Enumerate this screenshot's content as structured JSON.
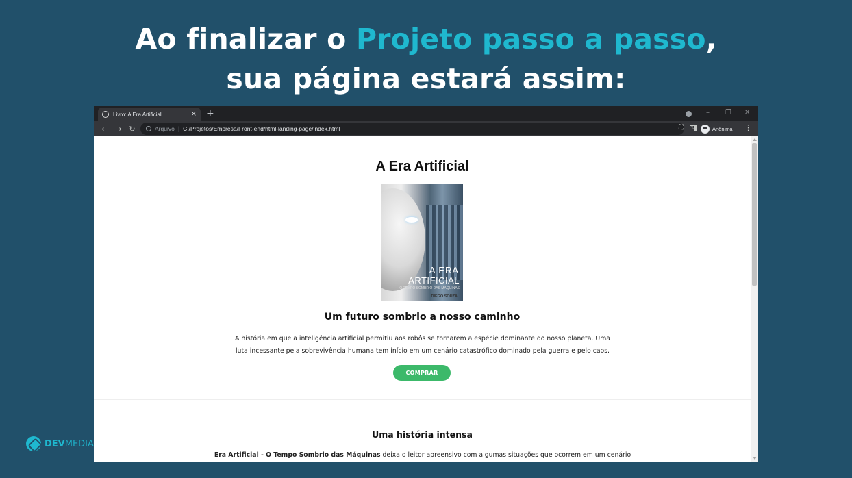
{
  "headline": {
    "line1_before": "Ao finalizar o ",
    "line1_accent": "Projeto passo a passo",
    "line1_after": ",",
    "line2": "sua página estará assim:"
  },
  "colors": {
    "background": "#21506a",
    "accent": "#1fb8cf",
    "buy_button": "#3cb96a"
  },
  "browser": {
    "tab_title": "Livro: A Era Artificial",
    "tab_close": "×",
    "new_tab": "+",
    "window_controls": {
      "minimize": "–",
      "maximize": "❐",
      "close": "✕"
    },
    "nav": {
      "back": "←",
      "forward": "→",
      "reload": "↻"
    },
    "address": {
      "scheme_label": "Arquivo",
      "separator": "|",
      "url": "C:/Projetos/Empresa/Front-end/html-landing-page/index.html"
    },
    "toolbar_icons": {
      "translate": "⛶",
      "bookmark": "☆",
      "menu": "⋮"
    },
    "profile_label": "Anônima"
  },
  "page": {
    "title": "A Era Artificial",
    "cover": {
      "title_line1": "A ERA",
      "title_line2": "ARTIFICIAL",
      "subtitle": "O TEMPO SOMBRIO DAS MÁQUINAS",
      "author": "DIEGO SOUZA"
    },
    "subtitle": "Um futuro sombrio a nosso caminho",
    "description": "A história em que a inteligência artificial permitiu aos robôs se tornarem a espécie dominante do nosso planeta. Uma luta incessante pela sobrevivência humana tem início em um cenário catastrófico dominado pela guerra e pelo caos.",
    "buy_label": "COMPRAR",
    "section2_title": "Uma história intensa",
    "section2_bold": "Era Artificial - O Tempo Sombrio das Máquinas",
    "section2_text": " deixa o leitor apreensivo com algumas situações que ocorrem em um cenário"
  },
  "logo": {
    "dev": "DEV",
    "media": "MEDIA"
  }
}
